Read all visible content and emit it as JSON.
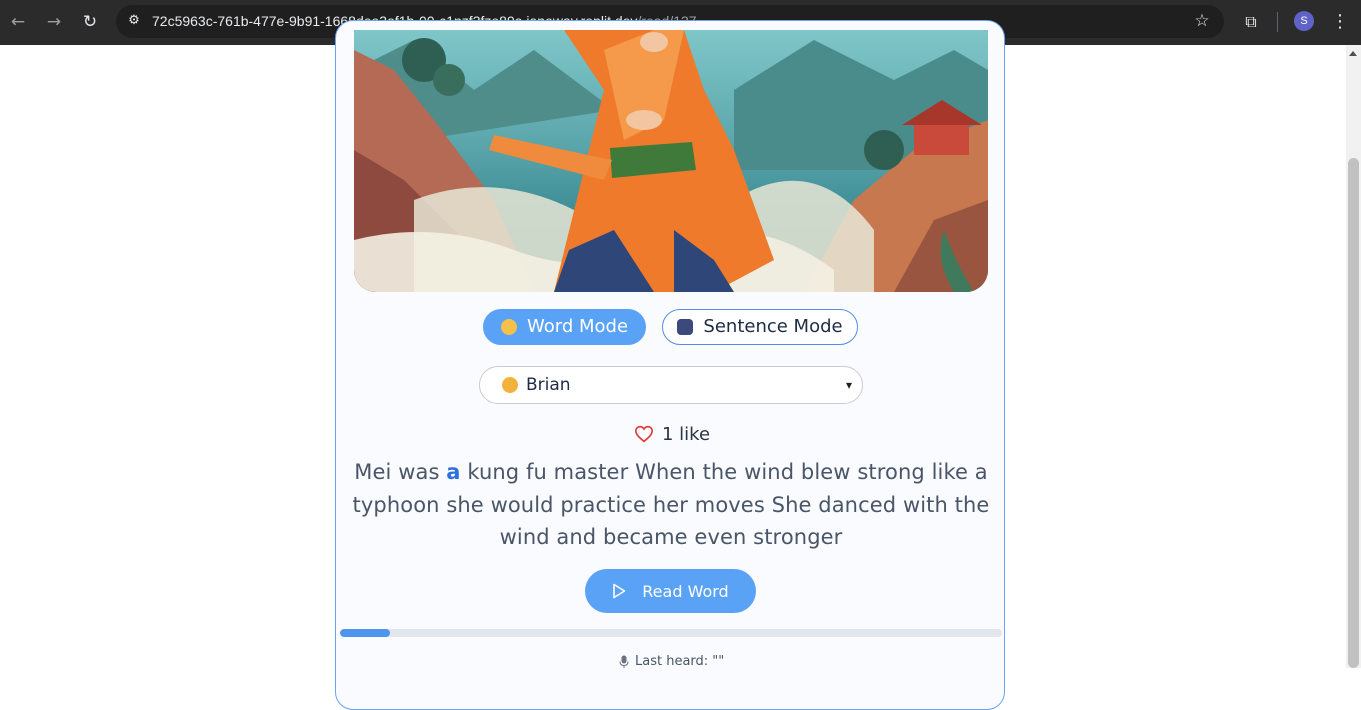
{
  "browser": {
    "url_host": "72c5963c-761b-477e-9b91-1668dee3af1b-00-c1nzf3fze89a.janeway.replit.dev",
    "url_path": "/read/137",
    "profile_initial": "S",
    "icons": {
      "back": "back-arrow-icon",
      "forward": "forward-arrow-icon",
      "reload": "reload-icon",
      "site_info": "site-info-icon",
      "bookmark": "star-icon",
      "extensions": "puzzle-icon",
      "menu": "kebab-menu-icon"
    }
  },
  "story": {
    "image_alt": "illustration",
    "modes": {
      "word_label": "Word Mode",
      "sentence_label": "Sentence Mode",
      "active": "word"
    },
    "voice": {
      "selected": "Brian"
    },
    "likes": {
      "text": "1 like"
    },
    "text_parts": {
      "before": "Mei was ",
      "highlight": "a",
      "after": " kung fu master When the wind blew strong like a typhoon she would practice her moves She danced with the wind and became even stronger"
    },
    "read_button_label": "Read Word",
    "progress": 0.075,
    "last_heard_text": "Last heard: \"\""
  },
  "colors": {
    "accent": "#5aa2f5",
    "highlight_word": "#2f6fde",
    "heart": "#e3373b"
  }
}
